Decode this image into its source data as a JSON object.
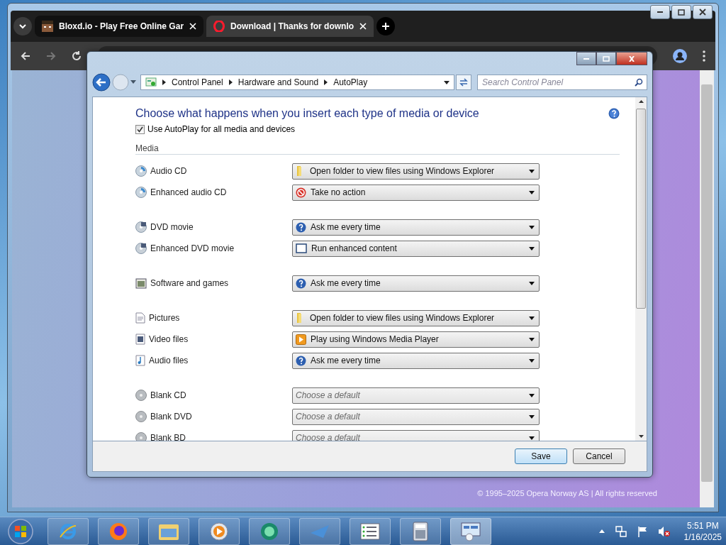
{
  "browser": {
    "tabs": [
      {
        "title": "Bloxd.io - Play Free Online Gar",
        "kind": "game",
        "selected": false
      },
      {
        "title": "Download | Thanks for downlo",
        "kind": "opera",
        "selected": true
      }
    ],
    "footer": "© 1995–2025 Opera Norway AS | All rights reserved"
  },
  "dialog": {
    "breadcrumb": [
      "Control Panel",
      "Hardware and Sound",
      "AutoPlay"
    ],
    "search": {
      "placeholder": "Search Control Panel"
    },
    "heading": "Choose what happens when you insert each type of media or device",
    "autoplay_all": {
      "label": "Use AutoPlay for all media and devices",
      "checked": true
    },
    "section": "Media",
    "groups": [
      {
        "items": [
          {
            "label": "Audio CD",
            "kind": "cd",
            "choice": {
              "kind": "folder",
              "text": "Open folder to view files using Windows Explorer"
            }
          },
          {
            "label": "Enhanced audio CD",
            "kind": "cd",
            "choice": {
              "kind": "stop",
              "text": "Take no action"
            }
          }
        ]
      },
      {
        "items": [
          {
            "label": "DVD movie",
            "kind": "dvd",
            "choice": {
              "kind": "question",
              "text": "Ask me every time"
            }
          },
          {
            "label": "Enhanced DVD movie",
            "kind": "dvd",
            "choice": {
              "kind": "window",
              "text": "Run enhanced content"
            }
          }
        ]
      },
      {
        "items": [
          {
            "label": "Software and games",
            "kind": "software",
            "choice": {
              "kind": "question",
              "text": "Ask me every time"
            }
          }
        ]
      },
      {
        "items": [
          {
            "label": "Pictures",
            "kind": "pictures",
            "choice": {
              "kind": "folder",
              "text": "Open folder to view files using Windows Explorer"
            }
          },
          {
            "label": "Video files",
            "kind": "video",
            "choice": {
              "kind": "media",
              "text": "Play using Windows Media Player"
            }
          },
          {
            "label": "Audio files",
            "kind": "audio",
            "choice": {
              "kind": "question",
              "text": "Ask me every time"
            }
          }
        ]
      },
      {
        "items": [
          {
            "label": "Blank CD",
            "kind": "blank",
            "placeholder": "Choose a default"
          },
          {
            "label": "Blank DVD",
            "kind": "blank",
            "placeholder": "Choose a default"
          },
          {
            "label": "Blank BD",
            "kind": "blank",
            "placeholder": "Choose a default"
          }
        ]
      }
    ],
    "buttons": [
      {
        "label": "Save",
        "kind": "default"
      },
      {
        "label": "Cancel",
        "kind": "normal"
      }
    ]
  },
  "taskbar": {
    "time": "5:51 PM",
    "date": "1/16/2025"
  }
}
